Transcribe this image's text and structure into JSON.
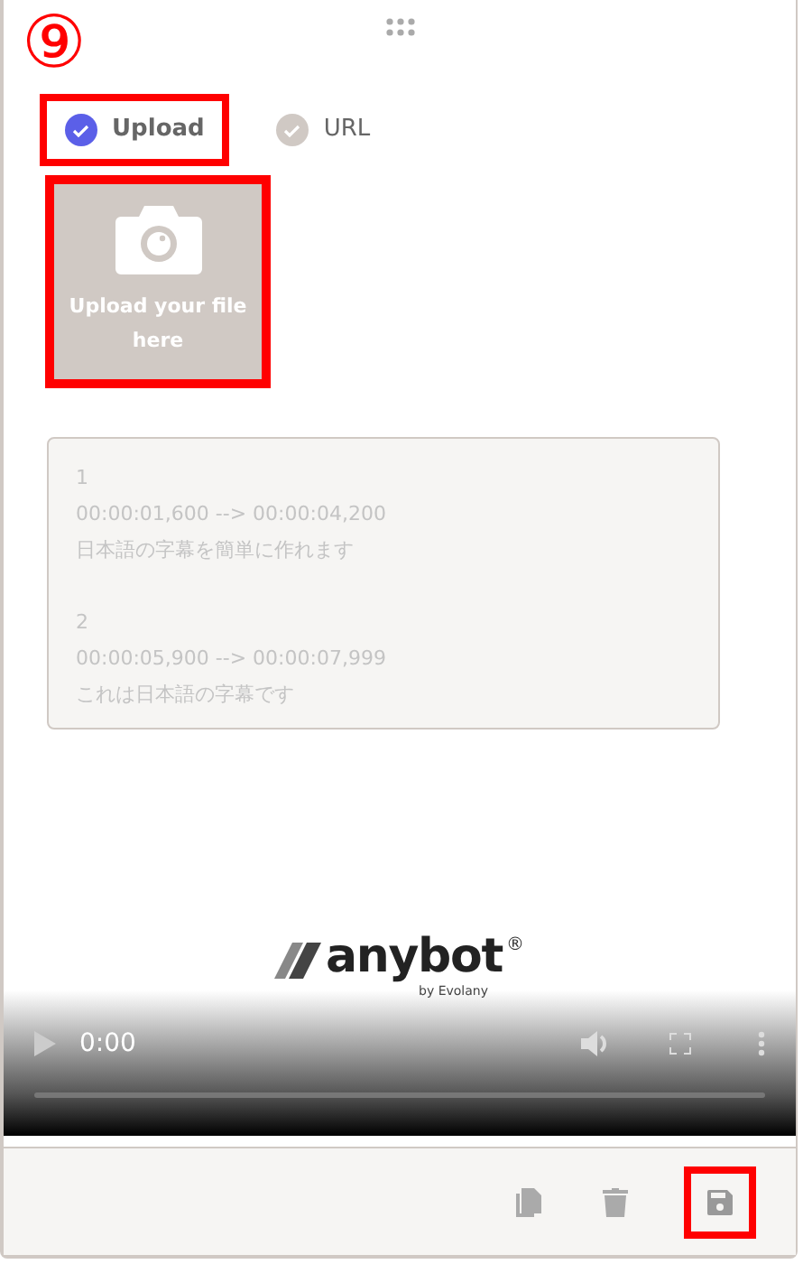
{
  "annotation": {
    "number": "⑨"
  },
  "source_options": [
    {
      "label": "Upload",
      "selected": true,
      "highlighted": true
    },
    {
      "label": "URL",
      "selected": false,
      "highlighted": false
    }
  ],
  "upload_tile": {
    "text": "Upload your file here",
    "highlighted": true
  },
  "subtitle_box": {
    "entries": [
      {
        "index": "1",
        "timing": "00:00:01,600 --> 00:00:04,200",
        "text": "日本語の字幕を簡単に作れます"
      },
      {
        "index": "2",
        "timing": "00:00:05,900 --> 00:00:07,999",
        "text": "これは日本語の字幕です"
      }
    ]
  },
  "video": {
    "logo_text": "anybot",
    "registered_mark": "®",
    "byline": "by Evolany",
    "time": "0:00"
  },
  "footer": {
    "actions": [
      {
        "kind": "copy",
        "highlighted": false
      },
      {
        "kind": "delete",
        "highlighted": false
      },
      {
        "kind": "save",
        "highlighted": true
      }
    ]
  }
}
